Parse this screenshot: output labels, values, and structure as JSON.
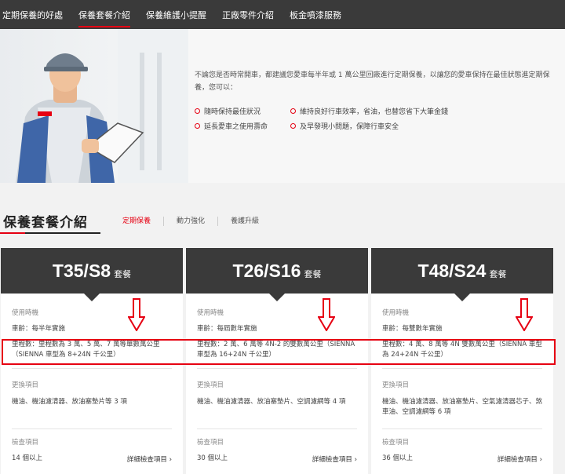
{
  "nav": {
    "items": [
      "定期保養的好處",
      "保養套餐介紹",
      "保養維護小提醒",
      "正廠零件介紹",
      "板金噴漆服務"
    ],
    "active_index": 1
  },
  "hero": {
    "intro": "不論您是否時常開車，都建議您愛車每半年或 1 萬公里回廠進行定期保養，以讓您的愛車保持在最佳狀態進定期保養，您可以：",
    "benefits": [
      "隨時保持最佳狀況",
      "維持良好行車效率，省油，也替您省下大筆金錢",
      "延長愛車之使用壽命",
      "及早發現小問題，保障行車安全"
    ]
  },
  "section": {
    "title": "保養套餐介紹",
    "tabs": [
      "定期保養",
      "動力強化",
      "養護升級"
    ],
    "active_tab": 0
  },
  "cards": [
    {
      "name": "T35/S8",
      "suffix": "套餐",
      "usage_label": "使用時機",
      "age": "車齡：每半年實施",
      "mileage": "里程數：里程數為 3 萬、5 萬、7 萬等單數萬公里（SIENNA 車型為 8+24N 千公里）",
      "replace_label": "更換項目",
      "replace": "機油、機油濾清器、放油塞墊片等 3 項",
      "inspect_label": "檢查項目",
      "inspect": "14 個以上",
      "more": "詳細檢查項目"
    },
    {
      "name": "T26/S16",
      "suffix": "套餐",
      "usage_label": "使用時機",
      "age": "車齡：每屆數年實施",
      "mileage": "里程數：2 萬、6 萬等 4N-2 的雙數萬公里（SIENNA 車型為 16+24N 千公里）",
      "replace_label": "更換項目",
      "replace": "機油、機油濾清器、放油塞墊片、空調濾網等 4 項",
      "inspect_label": "檢查項目",
      "inspect": "30 個以上",
      "more": "詳細檢查項目"
    },
    {
      "name": "T48/S24",
      "suffix": "套餐",
      "usage_label": "使用時機",
      "age": "車齡：每雙數年實施",
      "mileage": "里程數：4 萬、8 萬等 4N 雙數萬公里（SIENNA 車型為 24+24N 千公里）",
      "replace_label": "更換項目",
      "replace": "機油、機油濾清器、放油塞墊片、空氣濾清器芯子、煞車油、空調濾網等 6 項",
      "inspect_label": "檢查項目",
      "inspect": "36 個以上",
      "more": "詳細檢查項目"
    }
  ],
  "colors": {
    "accent": "#e60012",
    "nav_bg": "#3a3a3a",
    "card_head": "#3a3a3a"
  }
}
